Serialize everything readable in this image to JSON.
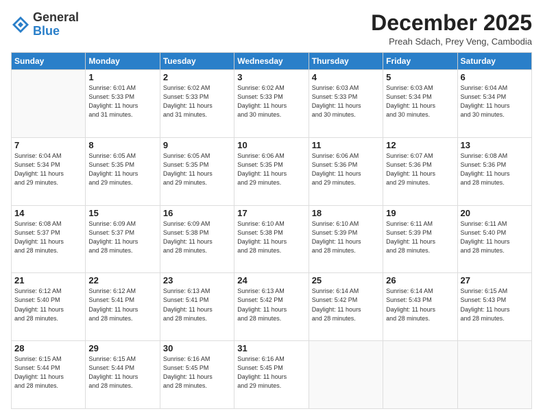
{
  "header": {
    "logo_general": "General",
    "logo_blue": "Blue",
    "month_title": "December 2025",
    "location": "Preah Sdach, Prey Veng, Cambodia"
  },
  "days_of_week": [
    "Sunday",
    "Monday",
    "Tuesday",
    "Wednesday",
    "Thursday",
    "Friday",
    "Saturday"
  ],
  "weeks": [
    [
      {
        "num": "",
        "info": ""
      },
      {
        "num": "1",
        "info": "Sunrise: 6:01 AM\nSunset: 5:33 PM\nDaylight: 11 hours\nand 31 minutes."
      },
      {
        "num": "2",
        "info": "Sunrise: 6:02 AM\nSunset: 5:33 PM\nDaylight: 11 hours\nand 31 minutes."
      },
      {
        "num": "3",
        "info": "Sunrise: 6:02 AM\nSunset: 5:33 PM\nDaylight: 11 hours\nand 30 minutes."
      },
      {
        "num": "4",
        "info": "Sunrise: 6:03 AM\nSunset: 5:33 PM\nDaylight: 11 hours\nand 30 minutes."
      },
      {
        "num": "5",
        "info": "Sunrise: 6:03 AM\nSunset: 5:34 PM\nDaylight: 11 hours\nand 30 minutes."
      },
      {
        "num": "6",
        "info": "Sunrise: 6:04 AM\nSunset: 5:34 PM\nDaylight: 11 hours\nand 30 minutes."
      }
    ],
    [
      {
        "num": "7",
        "info": "Sunrise: 6:04 AM\nSunset: 5:34 PM\nDaylight: 11 hours\nand 29 minutes."
      },
      {
        "num": "8",
        "info": "Sunrise: 6:05 AM\nSunset: 5:35 PM\nDaylight: 11 hours\nand 29 minutes."
      },
      {
        "num": "9",
        "info": "Sunrise: 6:05 AM\nSunset: 5:35 PM\nDaylight: 11 hours\nand 29 minutes."
      },
      {
        "num": "10",
        "info": "Sunrise: 6:06 AM\nSunset: 5:35 PM\nDaylight: 11 hours\nand 29 minutes."
      },
      {
        "num": "11",
        "info": "Sunrise: 6:06 AM\nSunset: 5:36 PM\nDaylight: 11 hours\nand 29 minutes."
      },
      {
        "num": "12",
        "info": "Sunrise: 6:07 AM\nSunset: 5:36 PM\nDaylight: 11 hours\nand 29 minutes."
      },
      {
        "num": "13",
        "info": "Sunrise: 6:08 AM\nSunset: 5:36 PM\nDaylight: 11 hours\nand 28 minutes."
      }
    ],
    [
      {
        "num": "14",
        "info": "Sunrise: 6:08 AM\nSunset: 5:37 PM\nDaylight: 11 hours\nand 28 minutes."
      },
      {
        "num": "15",
        "info": "Sunrise: 6:09 AM\nSunset: 5:37 PM\nDaylight: 11 hours\nand 28 minutes."
      },
      {
        "num": "16",
        "info": "Sunrise: 6:09 AM\nSunset: 5:38 PM\nDaylight: 11 hours\nand 28 minutes."
      },
      {
        "num": "17",
        "info": "Sunrise: 6:10 AM\nSunset: 5:38 PM\nDaylight: 11 hours\nand 28 minutes."
      },
      {
        "num": "18",
        "info": "Sunrise: 6:10 AM\nSunset: 5:39 PM\nDaylight: 11 hours\nand 28 minutes."
      },
      {
        "num": "19",
        "info": "Sunrise: 6:11 AM\nSunset: 5:39 PM\nDaylight: 11 hours\nand 28 minutes."
      },
      {
        "num": "20",
        "info": "Sunrise: 6:11 AM\nSunset: 5:40 PM\nDaylight: 11 hours\nand 28 minutes."
      }
    ],
    [
      {
        "num": "21",
        "info": "Sunrise: 6:12 AM\nSunset: 5:40 PM\nDaylight: 11 hours\nand 28 minutes."
      },
      {
        "num": "22",
        "info": "Sunrise: 6:12 AM\nSunset: 5:41 PM\nDaylight: 11 hours\nand 28 minutes."
      },
      {
        "num": "23",
        "info": "Sunrise: 6:13 AM\nSunset: 5:41 PM\nDaylight: 11 hours\nand 28 minutes."
      },
      {
        "num": "24",
        "info": "Sunrise: 6:13 AM\nSunset: 5:42 PM\nDaylight: 11 hours\nand 28 minutes."
      },
      {
        "num": "25",
        "info": "Sunrise: 6:14 AM\nSunset: 5:42 PM\nDaylight: 11 hours\nand 28 minutes."
      },
      {
        "num": "26",
        "info": "Sunrise: 6:14 AM\nSunset: 5:43 PM\nDaylight: 11 hours\nand 28 minutes."
      },
      {
        "num": "27",
        "info": "Sunrise: 6:15 AM\nSunset: 5:43 PM\nDaylight: 11 hours\nand 28 minutes."
      }
    ],
    [
      {
        "num": "28",
        "info": "Sunrise: 6:15 AM\nSunset: 5:44 PM\nDaylight: 11 hours\nand 28 minutes."
      },
      {
        "num": "29",
        "info": "Sunrise: 6:15 AM\nSunset: 5:44 PM\nDaylight: 11 hours\nand 28 minutes."
      },
      {
        "num": "30",
        "info": "Sunrise: 6:16 AM\nSunset: 5:45 PM\nDaylight: 11 hours\nand 28 minutes."
      },
      {
        "num": "31",
        "info": "Sunrise: 6:16 AM\nSunset: 5:45 PM\nDaylight: 11 hours\nand 29 minutes."
      },
      {
        "num": "",
        "info": ""
      },
      {
        "num": "",
        "info": ""
      },
      {
        "num": "",
        "info": ""
      }
    ]
  ]
}
